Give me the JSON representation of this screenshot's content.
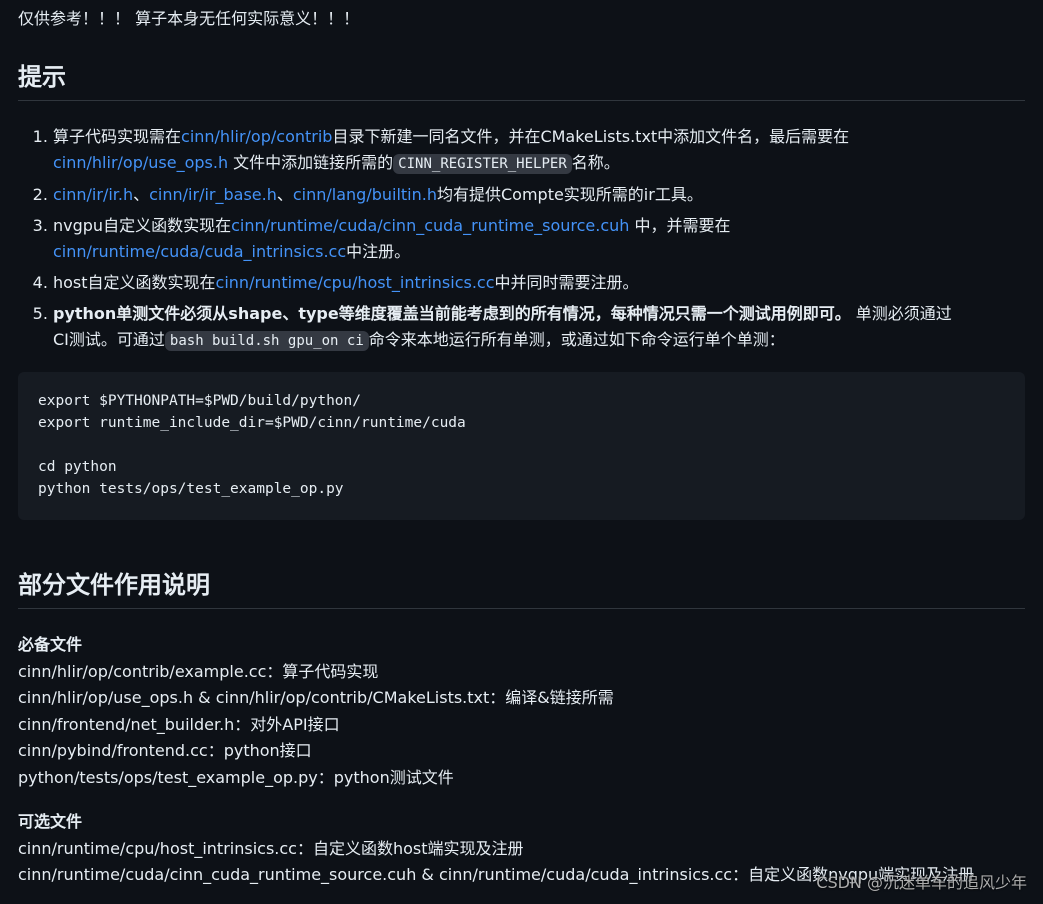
{
  "note": "仅供参考！！！ 算子本身无任何实际意义！！！",
  "tips": {
    "title": "提示",
    "items": [
      {
        "parts": [
          {
            "t": "算子代码实现需在"
          },
          {
            "t": "cinn/hlir/op/contrib",
            "k": "link"
          },
          {
            "t": "目录下新建一同名文件，并在CMakeLists.txt中添加文件名，最后需要在"
          },
          {
            "t": "br",
            "k": "br"
          },
          {
            "t": "cinn/hlir/op/use_ops.h",
            "k": "link"
          },
          {
            "t": " 文件中添加链接所需的"
          },
          {
            "t": "CINN_REGISTER_HELPER",
            "k": "code"
          },
          {
            "t": "名称。"
          }
        ]
      },
      {
        "parts": [
          {
            "t": "cinn/ir/ir.h",
            "k": "link"
          },
          {
            "t": "、"
          },
          {
            "t": "cinn/ir/ir_base.h",
            "k": "link"
          },
          {
            "t": "、"
          },
          {
            "t": "cinn/lang/builtin.h",
            "k": "link"
          },
          {
            "t": "均有提供Compte实现所需的ir工具。"
          }
        ]
      },
      {
        "parts": [
          {
            "t": "nvgpu自定义函数实现在"
          },
          {
            "t": "cinn/runtime/cuda/cinn_cuda_runtime_source.cuh",
            "k": "link"
          },
          {
            "t": " 中，并需要在"
          },
          {
            "t": "br",
            "k": "br"
          },
          {
            "t": "cinn/runtime/cuda/cuda_intrinsics.cc",
            "k": "link"
          },
          {
            "t": "中注册。"
          }
        ]
      },
      {
        "parts": [
          {
            "t": "host自定义函数实现在"
          },
          {
            "t": "cinn/runtime/cpu/host_intrinsics.cc",
            "k": "link"
          },
          {
            "t": "中并同时需要注册。"
          }
        ]
      },
      {
        "parts": [
          {
            "t": "python单测文件必须从shape、type等维度覆盖当前能考虑到的所有情况，每种情况只需一个测试用例即可。",
            "k": "bold"
          },
          {
            "t": " 单测必须通过"
          },
          {
            "t": "br",
            "k": "br"
          },
          {
            "t": "CI测试。可通过"
          },
          {
            "t": "bash build.sh gpu_on ci",
            "k": "code"
          },
          {
            "t": "命令来本地运行所有单测，或通过如下命令运行单个单测："
          }
        ]
      }
    ]
  },
  "code_lines": [
    "export $PYTHONPATH=$PWD/build/python/",
    "export runtime_include_dir=$PWD/cinn/runtime/cuda",
    "",
    "cd python",
    "python tests/ops/test_example_op.py"
  ],
  "files": {
    "title": "部分文件作用说明",
    "required": {
      "title": "必备文件",
      "lines": [
        "cinn/hlir/op/contrib/example.cc：算子代码实现",
        "cinn/hlir/op/use_ops.h & cinn/hlir/op/contrib/CMakeLists.txt：编译&链接所需",
        "cinn/frontend/net_builder.h：对外API接口",
        "cinn/pybind/frontend.cc：python接口",
        "python/tests/ops/test_example_op.py：python测试文件"
      ]
    },
    "optional": {
      "title": "可选文件",
      "lines": [
        "cinn/runtime/cpu/host_intrinsics.cc：自定义函数host端实现及注册",
        "cinn/runtime/cuda/cinn_cuda_runtime_source.cuh & cinn/runtime/cuda/cuda_intrinsics.cc：自定义函数nvgpu端实现及注册"
      ]
    }
  },
  "watermark": "CSDN @沉迷单车的追风少年",
  "colors": {
    "background": "#0d1117",
    "text": "#e6edf3",
    "link": "#4493f8",
    "code_bg": "#161b22"
  }
}
